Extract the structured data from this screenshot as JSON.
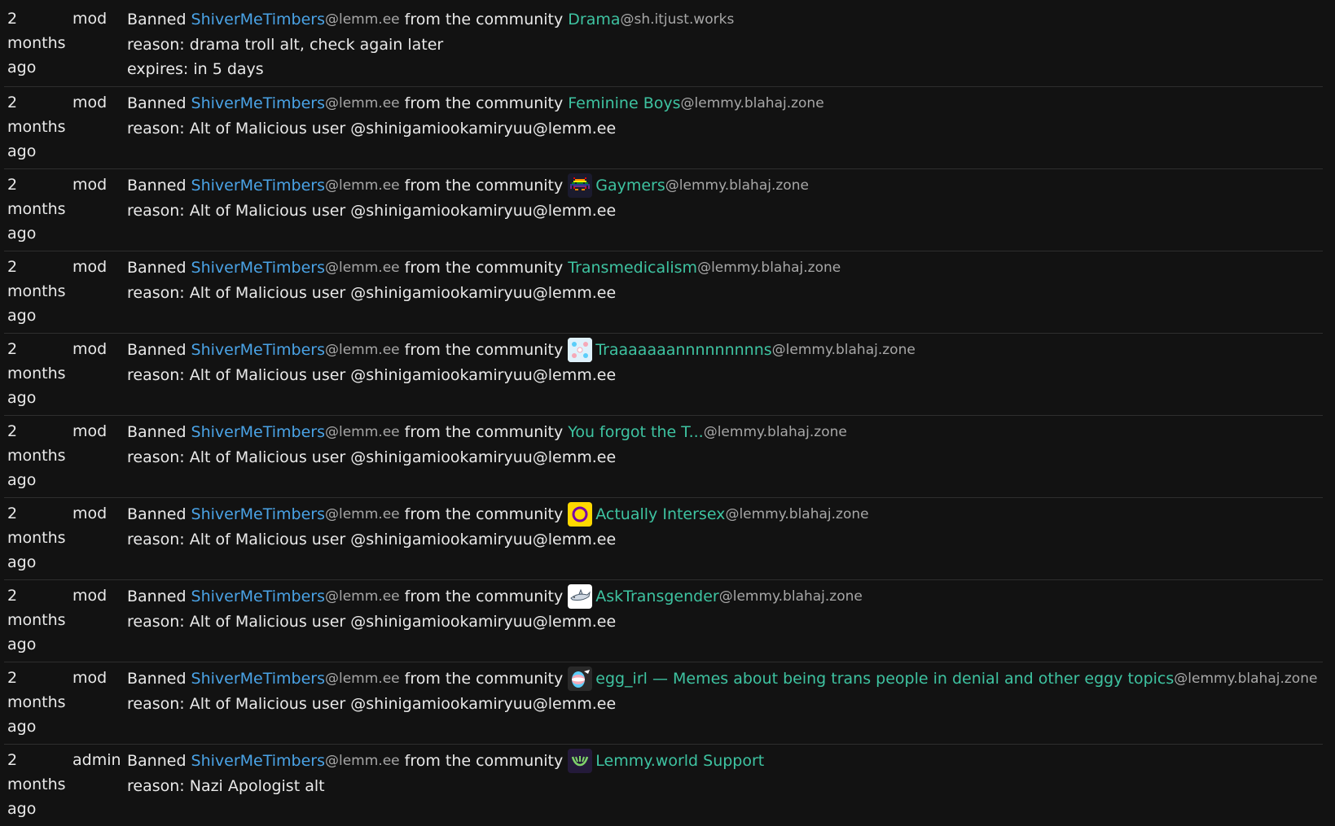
{
  "common": {
    "banned": "Banned",
    "user": "ShiverMeTimbers",
    "user_instance": "@lemm.ee",
    "from": "from the community",
    "when_1": "2",
    "when_2": "months",
    "when_3": "ago"
  },
  "entries": [
    {
      "role": "mod",
      "community": "Drama",
      "community_instance": "@sh.itjust.works",
      "icon": null,
      "reason": "reason: drama troll alt, check again later",
      "expires": "expires: in 5 days"
    },
    {
      "role": "mod",
      "community": "Feminine Boys",
      "community_instance": "@lemmy.blahaj.zone",
      "icon": null,
      "reason": "reason: Alt of Malicious user @shinigamiookamiryuu@lemm.ee"
    },
    {
      "role": "mod",
      "community": "Gaymers",
      "community_instance": "@lemmy.blahaj.zone",
      "icon": "rainbow-invader-icon",
      "reason": "reason: Alt of Malicious user @shinigamiookamiryuu@lemm.ee"
    },
    {
      "role": "mod",
      "community": "Transmedicalism",
      "community_instance": "@lemmy.blahaj.zone",
      "icon": null,
      "reason": "reason: Alt of Malicious user @shinigamiookamiryuu@lemm.ee"
    },
    {
      "role": "mod",
      "community": "Traaaaaaannnnnnnnns",
      "community_instance": "@lemmy.blahaj.zone",
      "icon": "trans-pattern-icon",
      "reason": "reason: Alt of Malicious user @shinigamiookamiryuu@lemm.ee"
    },
    {
      "role": "mod",
      "community": "You forgot the T...",
      "community_instance": "@lemmy.blahaj.zone",
      "icon": null,
      "reason": "reason: Alt of Malicious user @shinigamiookamiryuu@lemm.ee"
    },
    {
      "role": "mod",
      "community": "Actually Intersex",
      "community_instance": "@lemmy.blahaj.zone",
      "icon": "intersex-ring-icon",
      "reason": "reason: Alt of Malicious user @shinigamiookamiryuu@lemm.ee"
    },
    {
      "role": "mod",
      "community": "AskTransgender",
      "community_instance": "@lemmy.blahaj.zone",
      "icon": "shark-icon",
      "reason": "reason: Alt of Malicious user @shinigamiookamiryuu@lemm.ee"
    },
    {
      "role": "mod",
      "community": "egg_irl — Memes about being trans people in denial and other eggy topics",
      "community_instance": "@lemmy.blahaj.zone",
      "icon": "egg-flag-icon",
      "reason": "reason: Alt of Malicious user @shinigamiookamiryuu@lemm.ee"
    },
    {
      "role": "admin",
      "community": "Lemmy.world Support",
      "community_instance": "",
      "icon": "lemmy-world-icon",
      "reason": "reason: Nazi Apologist alt"
    }
  ]
}
